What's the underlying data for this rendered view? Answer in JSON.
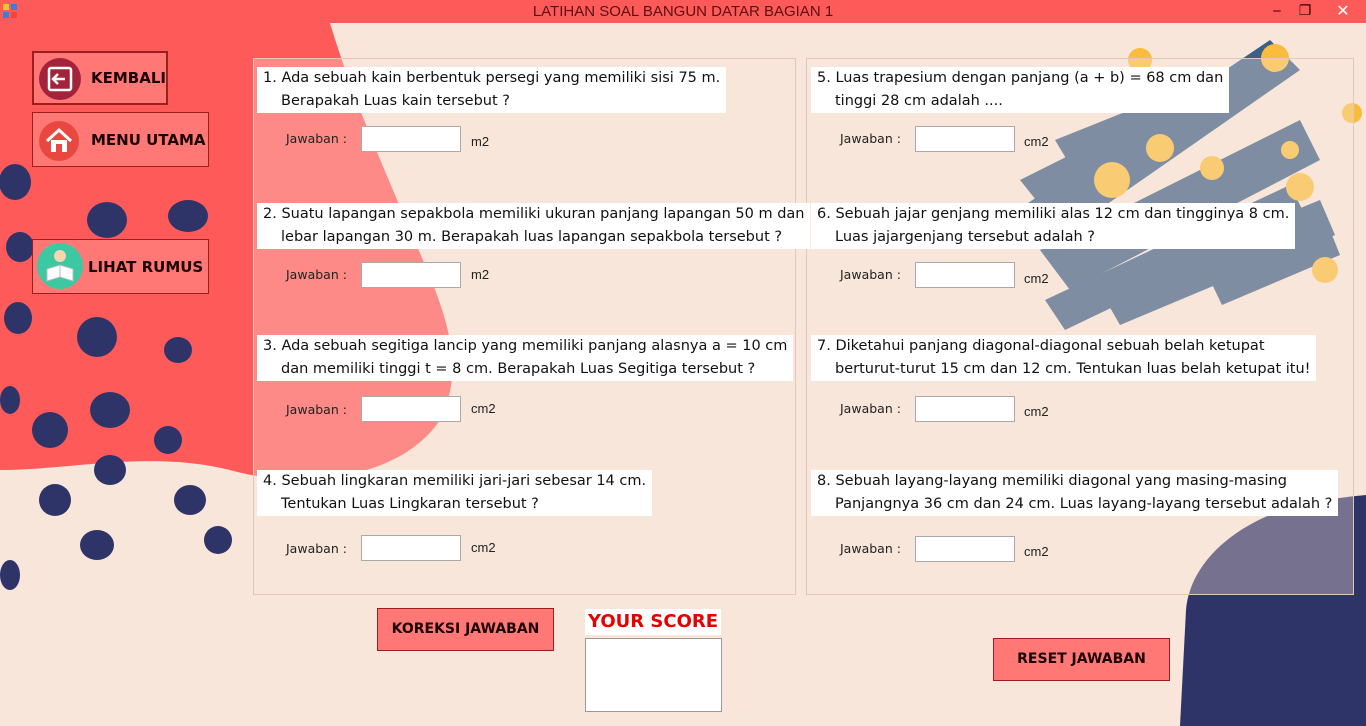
{
  "window": {
    "title": "LATIHAN SOAL BANGUN DATAR BAGIAN 1",
    "minimize": "‒",
    "maximize": "❐",
    "close": "✕"
  },
  "nav": {
    "back_label": "KEMBALI",
    "main_menu_label": "MENU UTAMA",
    "formula_label": "LIHAT RUMUS"
  },
  "answer_label": "Jawaban :",
  "questions": [
    {
      "line1": "1. Ada sebuah kain berbentuk persegi yang memiliki sisi 75 m.",
      "line2": "Berapakah Luas kain tersebut ?",
      "unit": "m2",
      "value": ""
    },
    {
      "line1": "2. Suatu lapangan sepakbola memiliki ukuran panjang lapangan 50 m dan",
      "line2": "lebar lapangan 30 m. Berapakah luas lapangan sepakbola tersebut ?",
      "unit": "m2",
      "value": ""
    },
    {
      "line1": "3. Ada sebuah segitiga lancip yang memiliki panjang alasnya a = 10 cm",
      "line2": "dan memiliki tinggi t = 8 cm. Berapakah Luas Segitiga tersebut ?",
      "unit": "cm2",
      "value": ""
    },
    {
      "line1": "4. Sebuah lingkaran memiliki jari-jari sebesar 14 cm.",
      "line2": "Tentukan Luas Lingkaran tersebut ?",
      "unit": "cm2",
      "value": ""
    },
    {
      "line1": "5. Luas trapesium dengan panjang (a + b) = 68 cm dan",
      "line2": "tinggi 28 cm adalah ....",
      "unit": "cm2",
      "value": ""
    },
    {
      "line1": "6. Sebuah jajar genjang memiliki alas 12 cm dan tingginya 8 cm.",
      "line2": "Luas jajargenjang tersebut adalah ?",
      "unit": "cm2",
      "value": ""
    },
    {
      "line1": "7. Diketahui panjang diagonal-diagonal sebuah belah ketupat",
      "line2": "berturut-turut 15 cm dan 12 cm. Tentukan luas belah ketupat itu!",
      "unit": "cm2",
      "value": ""
    },
    {
      "line1": "8. Sebuah layang-layang memiliki diagonal yang masing-masing",
      "line2": "Panjangnya 36 cm dan 24 cm. Luas layang-layang tersebut adalah ?",
      "unit": "cm2",
      "value": ""
    }
  ],
  "actions": {
    "check_label": "KOREKSI JAWABAN",
    "reset_label": "RESET JAWABAN"
  },
  "score": {
    "label": "YOUR SCORE",
    "value": ""
  },
  "colors": {
    "titlebar": "#ff5a5a",
    "background": "#f9e6da",
    "blob_red": "#ff5a5a",
    "dot_navy": "#2f3468",
    "stroke_blue": "#3c5f85",
    "dot_yellow": "#f9bd3d",
    "button_fill": "#ff7875",
    "score_red": "#e60000"
  }
}
